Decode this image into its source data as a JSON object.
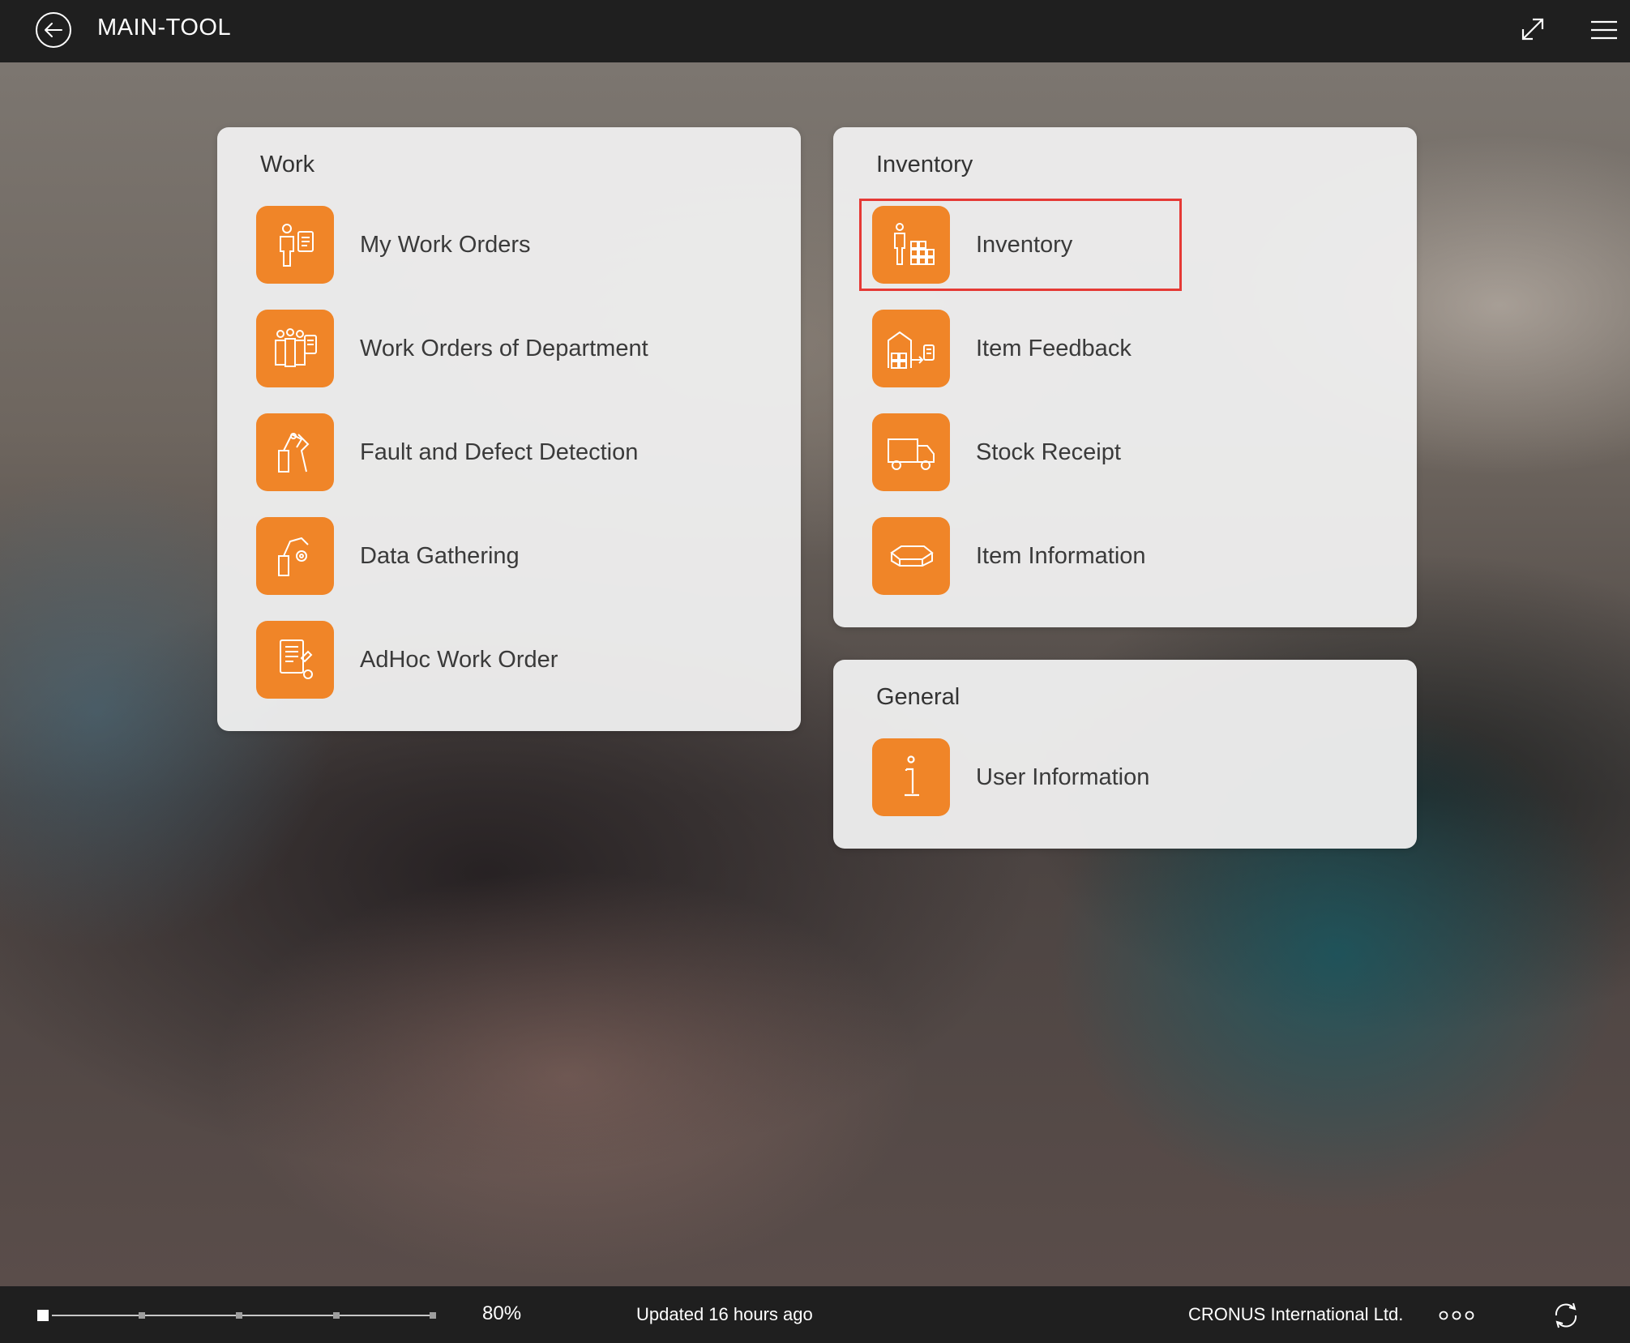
{
  "header": {
    "title": "MAIN-TOOL",
    "back_icon": "arrow-left-circle-icon",
    "expand_icon": "expand-icon",
    "menu_icon": "hamburger-menu-icon"
  },
  "colors": {
    "tile_orange": "#f08528",
    "bar_dark": "#1f1f1f",
    "highlight_red": "#e53935"
  },
  "sections": {
    "work": {
      "title": "Work",
      "items": [
        {
          "label": "My Work Orders",
          "icon": "worker-document-icon"
        },
        {
          "label": "Work Orders of Department",
          "icon": "team-document-icon"
        },
        {
          "label": "Fault and Defect Detection",
          "icon": "robot-arm-fault-icon"
        },
        {
          "label": "Data Gathering",
          "icon": "robot-arm-gear-icon"
        },
        {
          "label": "AdHoc Work Order",
          "icon": "document-pencil-icon"
        }
      ]
    },
    "inventory": {
      "title": "Inventory",
      "items": [
        {
          "label": "Inventory",
          "icon": "worker-boxes-icon"
        },
        {
          "label": "Item Feedback",
          "icon": "warehouse-feedback-icon"
        },
        {
          "label": "Stock Receipt",
          "icon": "truck-icon"
        },
        {
          "label": "Item Information",
          "icon": "package-icon"
        }
      ]
    },
    "general": {
      "title": "General",
      "items": [
        {
          "label": "User Information",
          "icon": "info-icon"
        }
      ]
    }
  },
  "footer": {
    "zoom_level": "80%",
    "zoom_fraction": 0.8,
    "status": "Updated 16 hours ago",
    "company": "CRONUS International Ltd.",
    "more_icon": "more-dots-icon",
    "sync_icon": "sync-icon"
  }
}
